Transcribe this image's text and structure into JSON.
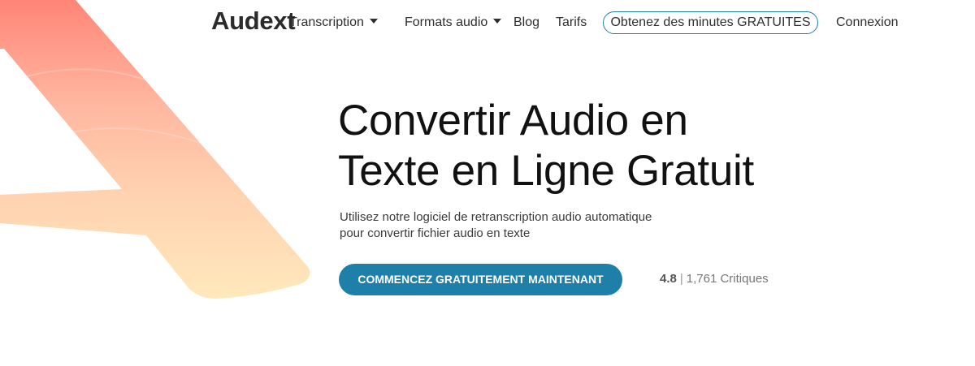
{
  "brand": {
    "logo_text": "Audext"
  },
  "nav": {
    "transcription": "Transcription",
    "formats": "Formats audio",
    "blog": "Blog",
    "pricing": "Tarifs",
    "free_minutes": "Obtenez des minutes GRATUITES",
    "login": "Connexion"
  },
  "hero": {
    "title_line1": "Convertir Audio en",
    "title_line2": "Texte en Ligne Gratuit",
    "subtitle_line1": "Utilisez notre logiciel de retranscription audio automatique",
    "subtitle_line2": "pour convertir fichier audio en texte",
    "cta_label": "COMMENCEZ GRATUITEMENT MAINTENANT",
    "rating_score": "4.8",
    "rating_sep": "|",
    "rating_text": "1,761 Critiques"
  },
  "colors": {
    "accent": "#1e7fa9",
    "outline": "#1f7fa5",
    "decor_top": "#ff8a7a",
    "decor_bottom": "#ffe7b8"
  },
  "icons": {
    "dropdown": "caret-down-icon",
    "decor": "brand-letter-a-graphic"
  }
}
